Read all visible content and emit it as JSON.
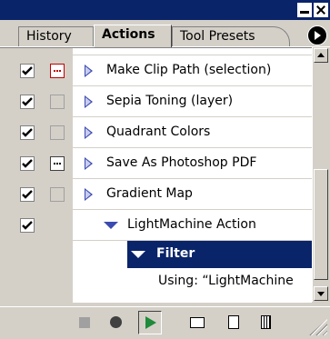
{
  "tabs": [
    {
      "label": "History"
    },
    {
      "label": "Actions"
    },
    {
      "label": "Tool Presets"
    }
  ],
  "icons": {
    "minimize": "minimize-icon",
    "close": "close-icon",
    "menu": "palette-menu-arrow-icon",
    "expand": "triangle-right-icon",
    "collapse": "triangle-down-icon",
    "stop": "stop-icon",
    "record": "record-icon",
    "play": "play-icon",
    "new_set": "folder-icon",
    "new_action": "new-action-icon",
    "delete": "trash-icon"
  },
  "rows": [
    {
      "label": "Make Clip Path (selection)"
    },
    {
      "label": "Sepia Toning (layer)"
    },
    {
      "label": "Quadrant Colors"
    },
    {
      "label": "Save As Photoshop PDF"
    },
    {
      "label": "Gradient Map"
    },
    {
      "label": "LightMachine Action"
    },
    {
      "label": "Filter"
    },
    {
      "label": "Using:  “LightMachine"
    }
  ],
  "colors": {
    "selection": "#0a246a",
    "triangle": "#3b4bb0",
    "play": "#1f8a3b",
    "dialog_red": "#c00000"
  }
}
